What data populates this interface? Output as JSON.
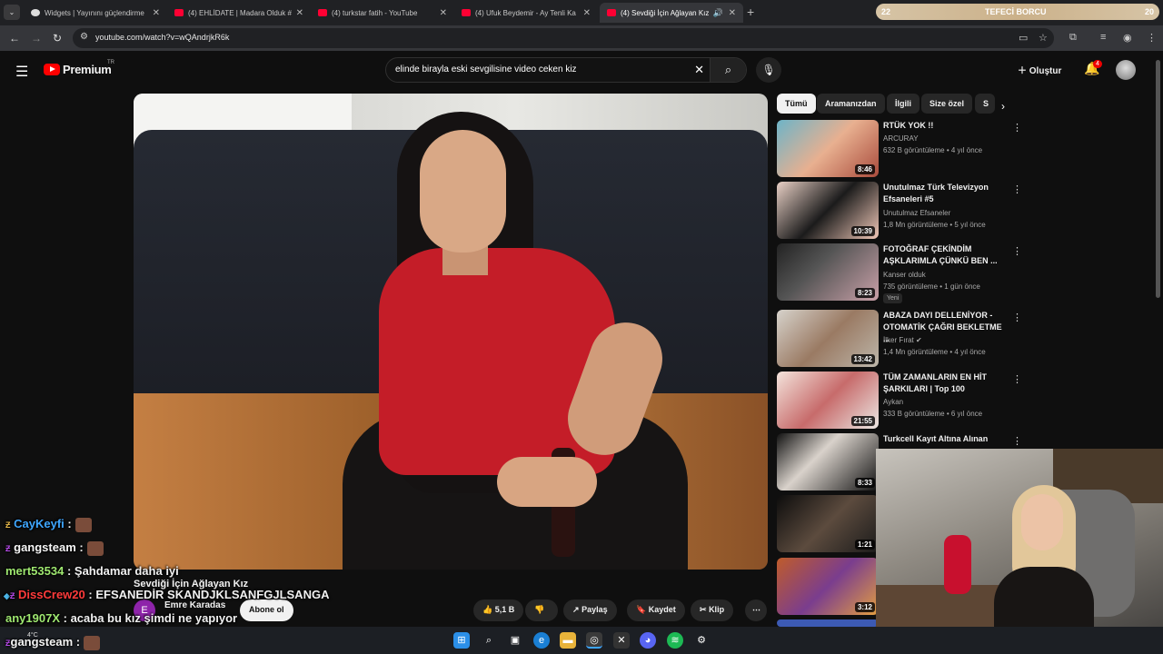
{
  "browser": {
    "tabs": [
      {
        "label": "Widgets | Yayınını güçlendirme"
      },
      {
        "label": "(4) EHLİDATE | Madara Olduk #"
      },
      {
        "label": "(4) turkstar fatih - YouTube"
      },
      {
        "label": "(4) Ufuk Beydemir - Ay Tenli Ka"
      },
      {
        "label": "(4) Sevdiği İçin Ağlayan Kız"
      }
    ],
    "url": "youtube.com/watch?v=wQAndrjkR6k"
  },
  "overlay": {
    "left": "22",
    "title": "TEFECİ BORCU",
    "right": "20"
  },
  "youtube": {
    "logo": "Premium",
    "region": "TR",
    "search_query": "elinde birayla eski sevgilisine video ceken kiz",
    "create_label": "Oluştur",
    "notif_count": "4"
  },
  "chips": [
    "Tümü",
    "Aramanızdan",
    "İlgili",
    "Size özel",
    "S"
  ],
  "related": [
    {
      "title": "RTÜK YOK !!",
      "channel": "ARCURAY",
      "meta": "632 B görüntüleme • 4 yıl önce",
      "duration": "8:46"
    },
    {
      "title": "Unutulmaz Türk Televizyon Efsaneleri #5",
      "channel": "Unutulmaz Efsaneler",
      "meta": "1,8 Mn görüntüleme • 5 yıl önce",
      "duration": "10:39"
    },
    {
      "title": "FOTOĞRAF ÇEKİNDİM AŞKLARIMLA ÇÜNKÜ BEN ...",
      "channel": "Kanser olduk",
      "meta": "735 görüntüleme • 1 gün önce",
      "duration": "8:23",
      "badge": "Yeni"
    },
    {
      "title": "ABAZA DAYI DELLENİYOR - OTOMATİK ÇAĞRI BEKLETME ...",
      "channel": "İlker Fırat",
      "meta": "1,4 Mn görüntüleme • 4 yıl önce",
      "duration": "13:42"
    },
    {
      "title": "TÜM ZAMANLARIN EN HİT ŞARKILARI | Top 100",
      "channel": "Aykan",
      "meta": "333 B görüntüleme • 6 yıl önce",
      "duration": "21:55"
    },
    {
      "title": "Turkcell Kayıt Altına Alınan",
      "channel": "",
      "meta": "",
      "duration": "8:33"
    },
    {
      "title": "",
      "channel": "",
      "meta": "",
      "duration": "1:21"
    },
    {
      "title": "",
      "channel": "",
      "meta": "",
      "duration": "3:12"
    }
  ],
  "video": {
    "title": "Sevdiği İçin Ağlayan Kız",
    "channel": "Emre Karadas",
    "channel_initial": "E",
    "subscribe": "Abone ol",
    "likes": "5,1 B",
    "share": "Paylaş",
    "save": "Kaydet",
    "clip": "Klip"
  },
  "chat": [
    {
      "user": "CayKeyfi",
      "sep": " :",
      "msg": ""
    },
    {
      "user": "gangsteam",
      "sep": " :",
      "msg": ""
    },
    {
      "user": "mert53534",
      "sep": " :",
      "msg": " Şahdamar daha iyi"
    },
    {
      "user": "DissCrew20",
      "sep": " :",
      "msg": " EFSANEDİR SKANDJKLSANFGJLSANGA"
    },
    {
      "user": "any1907X",
      "sep": " :",
      "msg": " acaba bu kız şimdi ne yapıyor"
    },
    {
      "user": "gangsteam",
      "sep": " :",
      "msg": ""
    }
  ],
  "system": {
    "temp": "4°C"
  },
  "colors": {
    "youtube_red": "#ff0000",
    "bg": "#0f0f0f",
    "chip": "#272727"
  }
}
